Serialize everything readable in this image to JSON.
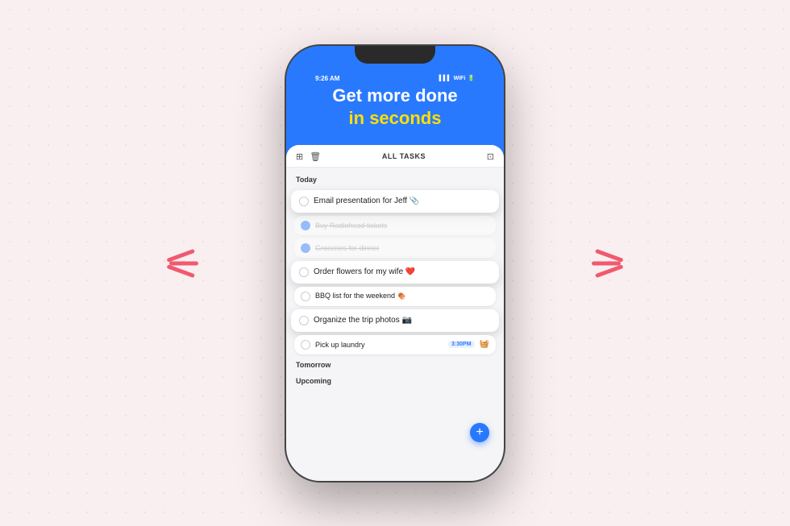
{
  "background": {
    "color": "#f9eef0"
  },
  "hero": {
    "line1": "Get more done",
    "line2": "in seconds"
  },
  "app": {
    "status_bar": {
      "time": "9:26 AM",
      "title": "ALL TASKS"
    },
    "sections": [
      {
        "label": "Today",
        "tasks": [
          {
            "id": 1,
            "text": "Email presentation for Jeff 📎",
            "completed": false,
            "elevated": true
          },
          {
            "id": 2,
            "text": "Buy Radiohead tickets",
            "completed": true,
            "elevated": false
          },
          {
            "id": 3,
            "text": "Groceries for dinner",
            "completed": true,
            "elevated": false
          },
          {
            "id": 4,
            "text": "Order flowers for my wife ❤️",
            "completed": false,
            "elevated": true
          },
          {
            "id": 5,
            "text": "BBQ list for the weekend 🍖",
            "completed": false,
            "elevated": false
          },
          {
            "id": 6,
            "text": "Organize the trip photos 📷",
            "completed": false,
            "elevated": true
          },
          {
            "id": 7,
            "text": "Pick up laundry",
            "completed": false,
            "elevated": false,
            "tag": "3:30PM"
          }
        ]
      },
      {
        "label": "Tomorrow",
        "tasks": []
      },
      {
        "label": "Upcoming",
        "tasks": []
      }
    ]
  },
  "decorative": {
    "left_lines": [
      "line1",
      "line2",
      "line3"
    ],
    "right_lines": [
      "line1",
      "line2",
      "line3"
    ]
  },
  "fab": "+"
}
